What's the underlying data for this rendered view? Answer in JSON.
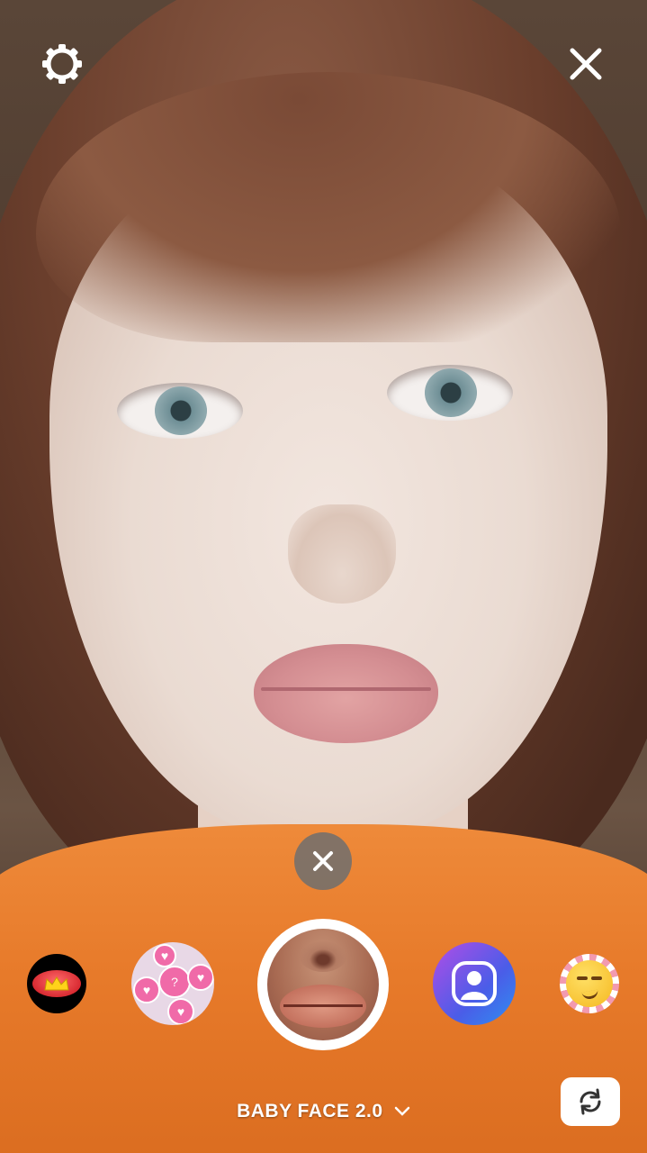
{
  "top_bar": {
    "settings_icon": "gear-icon",
    "close_icon": "close-icon"
  },
  "effect_tray": {
    "remove_icon": "close-icon",
    "effects": [
      {
        "icon": "red-lips-crown-effect"
      },
      {
        "icon": "heart-balloons-effect",
        "badge": "?"
      },
      {
        "icon": "lips-effect-selected",
        "selected": true
      },
      {
        "icon": "avatar-effect"
      },
      {
        "icon": "smirk-emoji-effect"
      }
    ]
  },
  "bottom_bar": {
    "effect_name": "BABY FACE 2.0",
    "flip_icon": "flip-camera-icon"
  },
  "colors": {
    "shirt": "#e77a2a",
    "avatar_gradient_start": "#b24de6",
    "avatar_gradient_end": "#2f8ff0"
  }
}
